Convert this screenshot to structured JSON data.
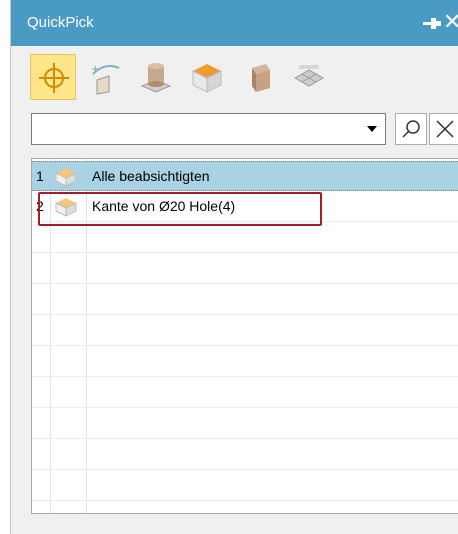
{
  "window": {
    "title": "QuickPick",
    "pin_icon": "pin-icon",
    "close_icon": "close-icon",
    "accent_color": "#4a9bc4"
  },
  "toolbar": {
    "buttons": [
      {
        "icon": "crosshair-icon",
        "active": true
      },
      {
        "icon": "edge-curve-icon",
        "active": false
      },
      {
        "icon": "cylinder-body-icon",
        "active": false
      },
      {
        "icon": "face-cube-icon",
        "active": false
      },
      {
        "icon": "solid-body-icon",
        "active": false
      },
      {
        "icon": "mesh-face-icon",
        "active": false
      }
    ]
  },
  "filter": {
    "value": "",
    "dropdown_icon": "chevron-down-icon",
    "search_icon": "search-icon",
    "clear_icon": "clear-x-icon"
  },
  "list": {
    "rows": [
      {
        "number": "1",
        "icon": "body-icon",
        "label": "Alle beabsichtigten",
        "selected": true
      },
      {
        "number": "2",
        "icon": "body-icon",
        "label": "Kante von Ø20 Hole(4)",
        "selected": false,
        "highlighted": true
      }
    ],
    "selected_color": "#a9d2e4",
    "highlight_color": "#a51d2a"
  }
}
